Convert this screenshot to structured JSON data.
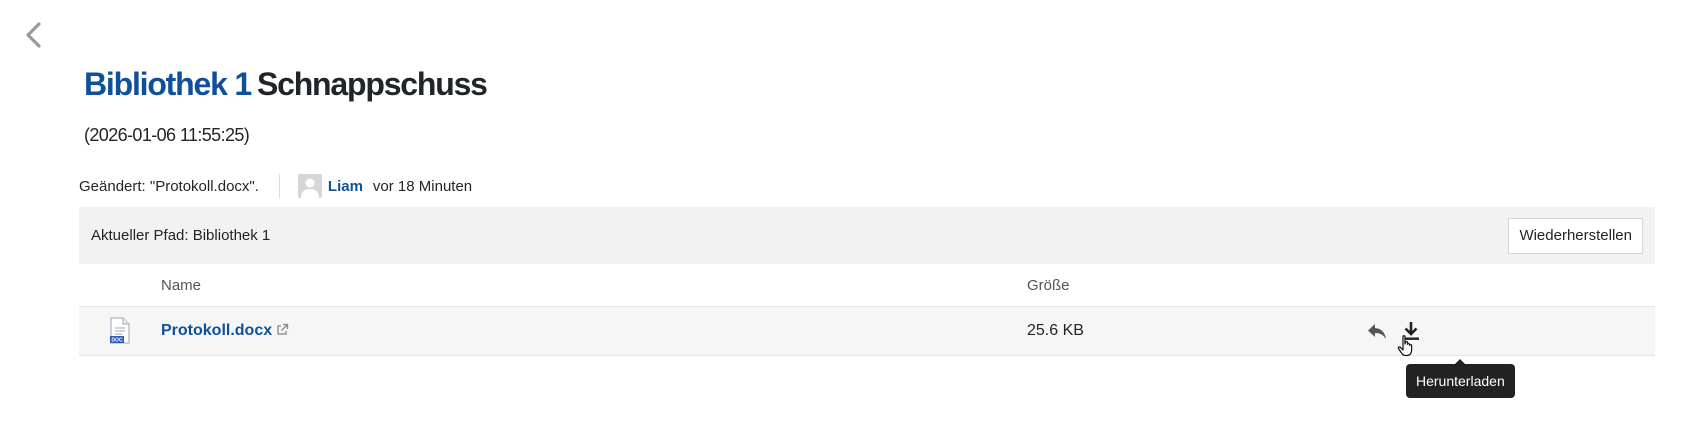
{
  "header": {
    "repo_name": "Bibliothek 1",
    "snapshot_label": "Schnappschuss",
    "timestamp": "(2026-01-06 11:55:25)"
  },
  "commit": {
    "description": "Geändert: \"Protokoll.docx\".",
    "author": "Liam",
    "time": "vor 18 Minuten"
  },
  "path_bar": {
    "current_path": "Aktueller Pfad: Bibliothek 1",
    "restore_label": "Wiederherstellen"
  },
  "table": {
    "columns": {
      "name": "Name",
      "size": "Größe"
    },
    "rows": [
      {
        "name": "Protokoll.docx",
        "size": "25.6 KB",
        "icon": "docx-file-icon"
      }
    ]
  },
  "tooltip": {
    "text": "Herunterladen"
  },
  "colors": {
    "link": "#0e5099",
    "path_bar_bg": "#f2f2f2",
    "row_bg": "#f6f6f6",
    "tooltip_bg": "#222222"
  }
}
